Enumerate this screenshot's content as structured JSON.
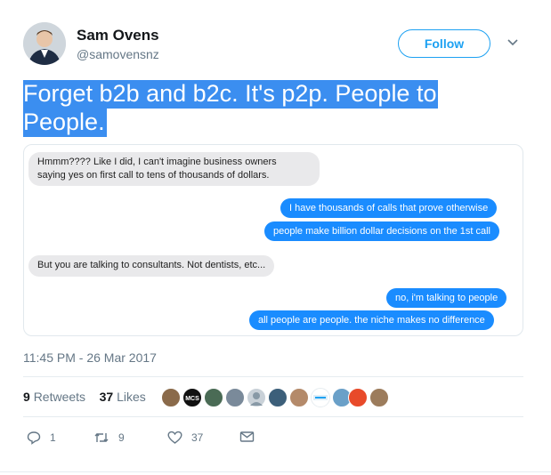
{
  "author": {
    "name": "Sam Ovens",
    "handle": "@samovensnz"
  },
  "header": {
    "follow_label": "Follow"
  },
  "tweet": {
    "text_line1": "Forget b2b and b2c. It's p2p. People to",
    "text_line2": "People."
  },
  "chat": {
    "messages": [
      {
        "side": "in",
        "text_line1": "Hmmm???? Like I did, I can't imagine business owners",
        "text_line2": "saying yes on first call to tens of thousands of dollars."
      },
      {
        "side": "out",
        "text": "I have thousands of calls that prove otherwise"
      },
      {
        "side": "out",
        "text": "people make billion dollar decisions on the 1st call"
      },
      {
        "side": "in",
        "text": "But you are talking to consultants. Not dentists, etc..."
      },
      {
        "side": "out",
        "text": "no, i'm talking to people"
      },
      {
        "side": "out",
        "text": "all people are people.  the niche makes no difference"
      }
    ]
  },
  "meta": {
    "timestamp": "11:45 PM - 26 Mar 2017"
  },
  "stats": {
    "retweets_count": "9",
    "retweets_label": "Retweets",
    "likes_count": "37",
    "likes_label": "Likes"
  },
  "actions": {
    "reply_count": "1",
    "retweet_count": "9",
    "like_count": "37"
  },
  "colors": {
    "accent": "#1da1f2",
    "selection": "#3b8ef0",
    "bubble_out": "#1a8cff",
    "bubble_in": "#e9e9eb"
  }
}
